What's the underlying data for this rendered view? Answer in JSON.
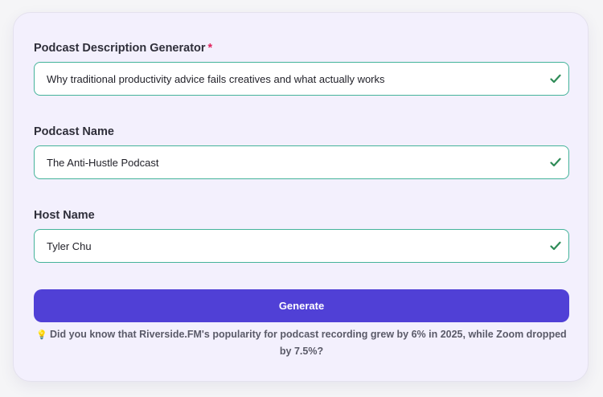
{
  "form": {
    "fields": [
      {
        "label": "Podcast Description Generator",
        "required_mark": "*",
        "value": "Why traditional productivity advice fails creatives and what actually works"
      },
      {
        "label": "Podcast Name",
        "value": "The Anti-Hustle Podcast"
      },
      {
        "label": "Host Name",
        "value": "Tyler Chu"
      }
    ],
    "generate_label": "Generate",
    "tip_icon": "💡",
    "tip_text": "Did you know that Riverside.FM's popularity for podcast recording grew by 6% in 2025, while Zoom dropped by 7.5%?"
  },
  "colors": {
    "card_bg": "#f3f0fd",
    "field_border": "#44b39a",
    "check": "#2e8b57",
    "button": "#5040d6",
    "required": "#e0245e"
  },
  "icons": {
    "field_status": "check-icon",
    "tip": "lightbulb-icon"
  }
}
